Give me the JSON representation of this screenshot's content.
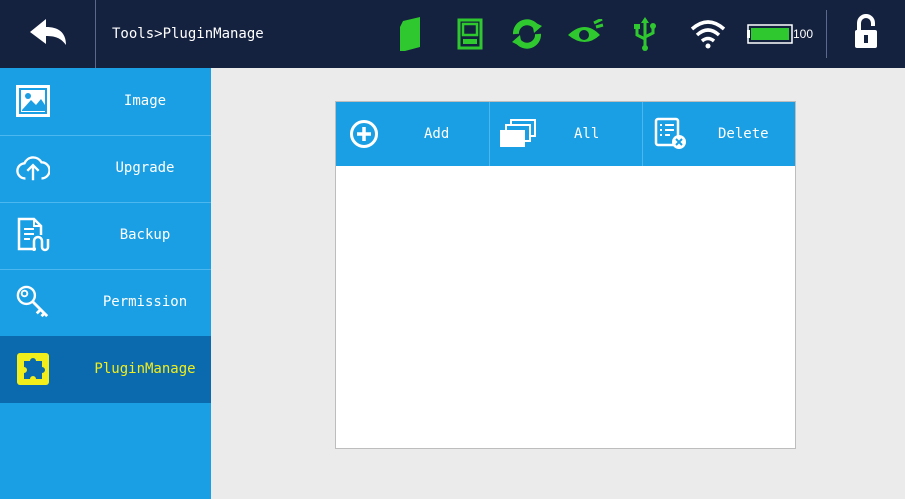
{
  "header": {
    "breadcrumb": "Tools>PluginManage",
    "battery_level": "100",
    "status_icons": [
      "back-arrow-icon",
      "card-icon",
      "terminal-icon",
      "sync-icon",
      "eye-icon",
      "usb-icon",
      "wifi-icon",
      "battery-icon",
      "unlock-icon"
    ],
    "status_color": "#2fc82f"
  },
  "sidebar": {
    "items": [
      {
        "label": "Image",
        "icon": "image-icon"
      },
      {
        "label": "Upgrade",
        "icon": "cloud-upload-icon"
      },
      {
        "label": "Backup",
        "icon": "document-backup-icon"
      },
      {
        "label": "Permission",
        "icon": "key-icon"
      },
      {
        "label": "PluginManage",
        "icon": "puzzle-icon",
        "active": true
      }
    ]
  },
  "plugin_panel": {
    "toolbar": {
      "add_label": "Add",
      "all_label": "All",
      "delete_label": "Delete"
    },
    "items": []
  },
  "colors": {
    "topbar": "#14213f",
    "accent": "#1a9fe4",
    "active": "#0a6aad",
    "active_text": "#f2ee1c"
  }
}
